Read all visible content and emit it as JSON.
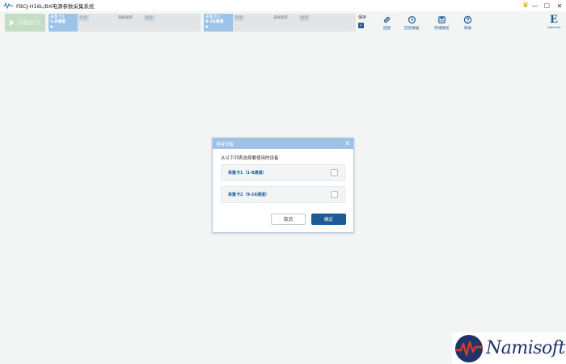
{
  "window": {
    "title": "FBCJ-H16L/BX电源参数采集系统",
    "minimize": "—",
    "maximize": "☐",
    "close": "✕"
  },
  "toolbar": {
    "start_label": "开始运行",
    "cards": [
      {
        "name": "采集卡1",
        "channels": "1-8通道",
        "chip1": "时基",
        "rate_label": "采样速率",
        "chip2": "触发"
      },
      {
        "name": "采集卡2",
        "channels": "9-16通道",
        "chip1": "时基",
        "rate_label": "采样速率",
        "chip2": "触发"
      }
    ],
    "save_label": "保存",
    "save_checked": true,
    "buttons": [
      {
        "label": "连接",
        "icon": "link-icon"
      },
      {
        "label": "历史数据",
        "icon": "history-icon"
      },
      {
        "label": "存储路径",
        "icon": "storage-icon"
      },
      {
        "label": "帮助",
        "icon": "help-icon"
      }
    ],
    "logo_letter": "E",
    "logo_caption": "Namisoft"
  },
  "dialog": {
    "title": "连接设备",
    "prompt": "从以下列表选择要使用的设备",
    "options": [
      {
        "label": "采集卡1（1-8通道）",
        "checked": false
      },
      {
        "label": "采集卡2（9-16通道）",
        "checked": false
      }
    ],
    "cancel_label": "取消",
    "ok_label": "确定"
  },
  "watermark": {
    "text": "Namisoft"
  },
  "colors": {
    "accent": "#1d5b97",
    "dialog_header": "#9ec2e6",
    "start_button": "#c3dec4",
    "background": "#f3f4f4"
  }
}
